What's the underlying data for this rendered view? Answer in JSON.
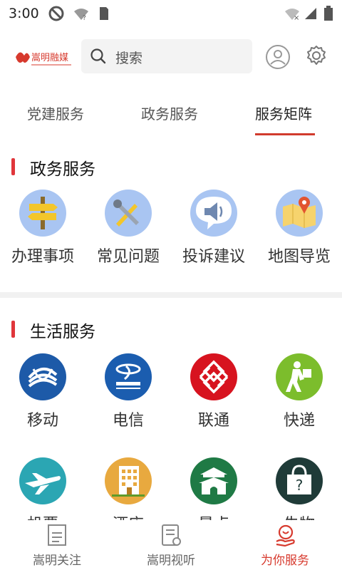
{
  "status": {
    "time": "3:00"
  },
  "header": {
    "logo_alt": "嵩明融媒",
    "search": {
      "placeholder": "搜索"
    }
  },
  "tabs": [
    {
      "label": "党建服务",
      "active": false
    },
    {
      "label": "政务服务",
      "active": false
    },
    {
      "label": "服务矩阵",
      "active": true
    }
  ],
  "sections": [
    {
      "title": "政务服务",
      "items": [
        {
          "label": "办理事项",
          "icon": "signpost-icon"
        },
        {
          "label": "常见问题",
          "icon": "wrench-pencil-icon"
        },
        {
          "label": "投诉建议",
          "icon": "speaker-chat-icon"
        },
        {
          "label": "地图导览",
          "icon": "map-pin-icon"
        }
      ]
    },
    {
      "title": "生活服务",
      "items": [
        {
          "label": "移动",
          "icon": "china-mobile-icon"
        },
        {
          "label": "电信",
          "icon": "china-telecom-icon"
        },
        {
          "label": "联通",
          "icon": "china-unicom-icon"
        },
        {
          "label": "快递",
          "icon": "courier-icon"
        },
        {
          "label": "机票",
          "icon": "airplane-icon"
        },
        {
          "label": "酒店",
          "icon": "hotel-icon"
        },
        {
          "label": "景点",
          "icon": "gate-tower-icon"
        },
        {
          "label": "失物",
          "icon": "lost-bag-icon"
        }
      ]
    }
  ],
  "bottom_nav": [
    {
      "label": "嵩明关注",
      "icon": "news-icon",
      "active": false
    },
    {
      "label": "嵩明视听",
      "icon": "media-doc-icon",
      "active": false
    },
    {
      "label": "为你服务",
      "icon": "service-hand-icon",
      "active": true
    }
  ],
  "colors": {
    "accent": "#d13b2d",
    "section_bar": "#e0363b"
  }
}
